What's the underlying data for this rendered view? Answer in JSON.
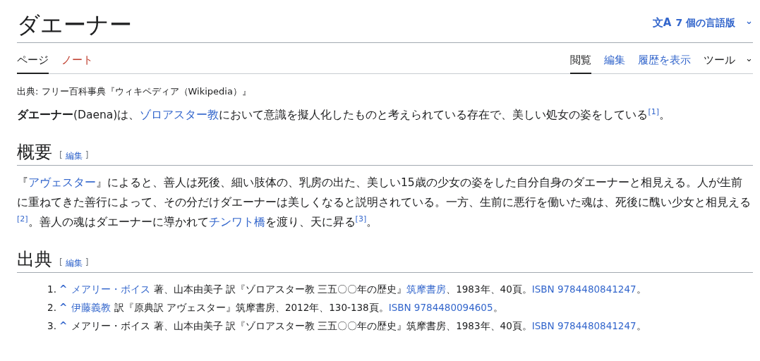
{
  "title": "ダエーナー",
  "languages": {
    "icon": "文A",
    "label": "7 個の言語版",
    "caret": "⌄"
  },
  "namespace_tabs": [
    {
      "label": "ページ",
      "selected": true,
      "missing": false
    },
    {
      "label": "ノート",
      "selected": false,
      "missing": true
    }
  ],
  "view_tabs": [
    {
      "label": "閲覧",
      "selected": true
    },
    {
      "label": "編集",
      "selected": false
    },
    {
      "label": "履歴を表示",
      "selected": false
    }
  ],
  "tools": {
    "label": "ツール",
    "caret": "⌄"
  },
  "source_line": "出典: フリー百科事典『ウィキペディア（Wikipedia）』",
  "lead": [
    {
      "kind": "bold",
      "text": "ダエーナー"
    },
    {
      "kind": "text",
      "text": "(Daena)は、"
    },
    {
      "kind": "link",
      "text": "ゾロアスター教"
    },
    {
      "kind": "text",
      "text": "において意識を擬人化したものと考えられている存在で、美しい処女の姿をしている"
    },
    {
      "kind": "ref",
      "text": "[1]"
    },
    {
      "kind": "text",
      "text": "。"
    }
  ],
  "sections": [
    {
      "heading": "概要",
      "edit": {
        "open": "[",
        "label": "編集",
        "close": "]"
      },
      "paragraph": [
        {
          "kind": "text",
          "text": "『"
        },
        {
          "kind": "link",
          "text": "アヴェスター"
        },
        {
          "kind": "text",
          "text": "』によると、善人は死後、細い肢体の、乳房の出た、美しい15歳の少女の姿をした自分自身のダエーナーと相見える。人が生前に重ねてきた善行によって、その分だけダエーナーは美しくなると説明されている。一方、生前に悪行を働いた魂は、死後に醜い少女と相見える"
        },
        {
          "kind": "ref",
          "text": "[2]"
        },
        {
          "kind": "text",
          "text": "。善人の魂はダエーナーに導かれて"
        },
        {
          "kind": "link",
          "text": "チンワト橋"
        },
        {
          "kind": "text",
          "text": "を渡り、天に昇る"
        },
        {
          "kind": "ref",
          "text": "[3]"
        },
        {
          "kind": "text",
          "text": "。"
        }
      ]
    },
    {
      "heading": "出典",
      "edit": {
        "open": "[",
        "label": "編集",
        "close": "]"
      },
      "references": [
        {
          "number": "1.",
          "backlink": "^",
          "parts": [
            {
              "kind": "link",
              "text": "メアリー・ボイス"
            },
            {
              "kind": "text",
              "text": " 著、山本由美子 訳『ゾロアスター教 三五〇〇年の歴史』"
            },
            {
              "kind": "link",
              "text": "筑摩書房"
            },
            {
              "kind": "text",
              "text": "、1983年、40頁。"
            },
            {
              "kind": "link",
              "text": "ISBN 9784480841247"
            },
            {
              "kind": "text",
              "text": "。"
            }
          ]
        },
        {
          "number": "2.",
          "backlink": "^",
          "parts": [
            {
              "kind": "link",
              "text": "伊藤義教"
            },
            {
              "kind": "text",
              "text": " 訳『原典訳 アヴェスター』筑摩書房、2012年、130-138頁。"
            },
            {
              "kind": "link",
              "text": "ISBN 9784480094605"
            },
            {
              "kind": "text",
              "text": "。"
            }
          ]
        },
        {
          "number": "3.",
          "backlink": "^",
          "parts": [
            {
              "kind": "text",
              "text": "メアリー・ボイス 著、山本由美子 訳『ゾロアスター教 三五〇〇年の歴史』筑摩書房、1983年、40頁。"
            },
            {
              "kind": "link",
              "text": "ISBN 9784480841247"
            },
            {
              "kind": "text",
              "text": "。"
            }
          ]
        }
      ]
    }
  ]
}
